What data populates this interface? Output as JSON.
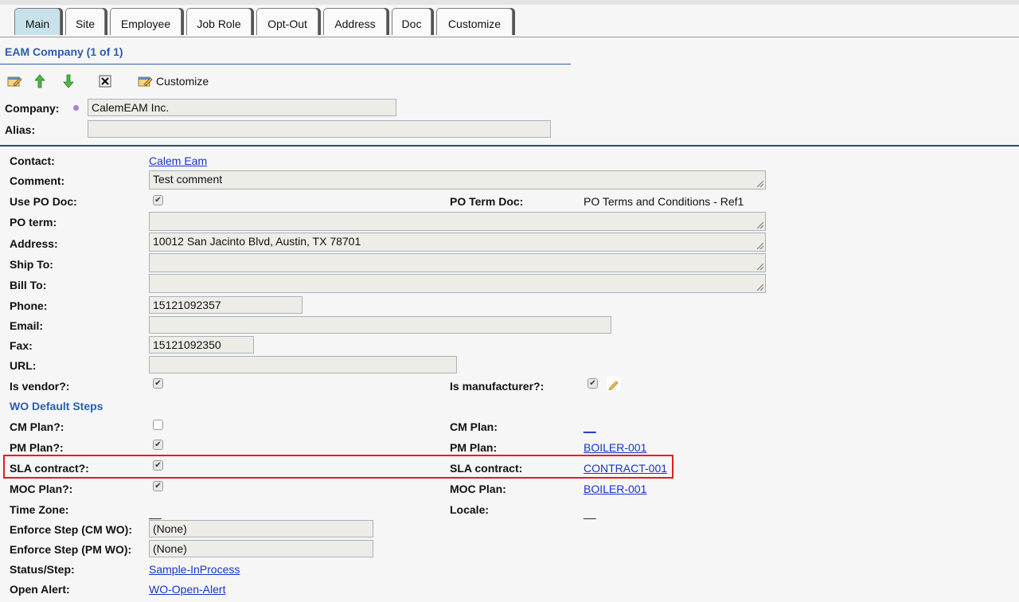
{
  "tabs": [
    {
      "label": "Main",
      "active": true
    },
    {
      "label": "Site"
    },
    {
      "label": "Employee"
    },
    {
      "label": "Job Role"
    },
    {
      "label": "Opt-Out"
    },
    {
      "label": "Address"
    },
    {
      "label": "Doc"
    },
    {
      "label": "Customize"
    }
  ],
  "section_title": "EAM Company (1 of 1)",
  "toolbar": {
    "icons": [
      "edit-icon",
      "move-up-icon",
      "move-down-icon",
      "delete-icon",
      "customize-icon"
    ],
    "customize_label": "Customize"
  },
  "header_fields": {
    "company_label": "Company:",
    "company_value": "CalemEAM Inc.",
    "alias_label": "Alias:",
    "alias_value": ""
  },
  "form": {
    "contact_label": "Contact:",
    "contact_value": "Calem Eam",
    "comment_label": "Comment:",
    "comment_value": "Test comment",
    "use_po_doc_label": "Use PO Doc:",
    "use_po_doc_checked": true,
    "po_term_doc_label": "PO Term Doc:",
    "po_term_doc_value": "PO Terms and Conditions - Ref1",
    "po_term_label": "PO term:",
    "po_term_value": "",
    "address_label": "Address:",
    "address_value": "10012 San Jacinto Blvd, Austin, TX 78701",
    "ship_to_label": "Ship To:",
    "ship_to_value": "",
    "bill_to_label": "Bill To:",
    "bill_to_value": "",
    "phone_label": "Phone:",
    "phone_value": "15121092357",
    "email_label": "Email:",
    "email_value": "",
    "fax_label": "Fax:",
    "fax_value": "15121092350",
    "url_label": "URL:",
    "url_value": "",
    "is_vendor_label": "Is vendor?:",
    "is_vendor_checked": true,
    "is_manufacturer_label": "Is manufacturer?:",
    "is_manufacturer_checked": true
  },
  "wo": {
    "heading": "WO Default Steps",
    "cm_plan_q_label": "CM Plan?:",
    "cm_plan_q_checked": false,
    "cm_plan_label": "CM Plan:",
    "cm_plan_value": "__",
    "pm_plan_q_label": "PM Plan?:",
    "pm_plan_q_checked": true,
    "pm_plan_label": "PM Plan:",
    "pm_plan_value": "BOILER-001",
    "sla_q_label": "SLA contract?:",
    "sla_q_checked": true,
    "sla_label": "SLA contract:",
    "sla_value": "CONTRACT-001",
    "moc_q_label": "MOC Plan?:",
    "moc_q_checked": true,
    "moc_label": "MOC Plan:",
    "moc_value": "BOILER-001",
    "time_zone_label": "Time Zone:",
    "time_zone_value": "__",
    "locale_label": "Locale:",
    "locale_value": "__",
    "enforce_cm_label": "Enforce Step (CM WO):",
    "enforce_cm_value": "(None)",
    "enforce_pm_label": "Enforce Step (PM WO):",
    "enforce_pm_value": "(None)",
    "status_step_label": "Status/Step:",
    "status_step_value": "Sample-InProcess",
    "open_alert_label": "Open Alert:",
    "open_alert_value": "WO-Open-Alert"
  },
  "colors": {
    "accent": "#2a5db0",
    "link": "#1a33cc",
    "highlight": "#e02020",
    "active_tab": "#c7e2ea"
  }
}
